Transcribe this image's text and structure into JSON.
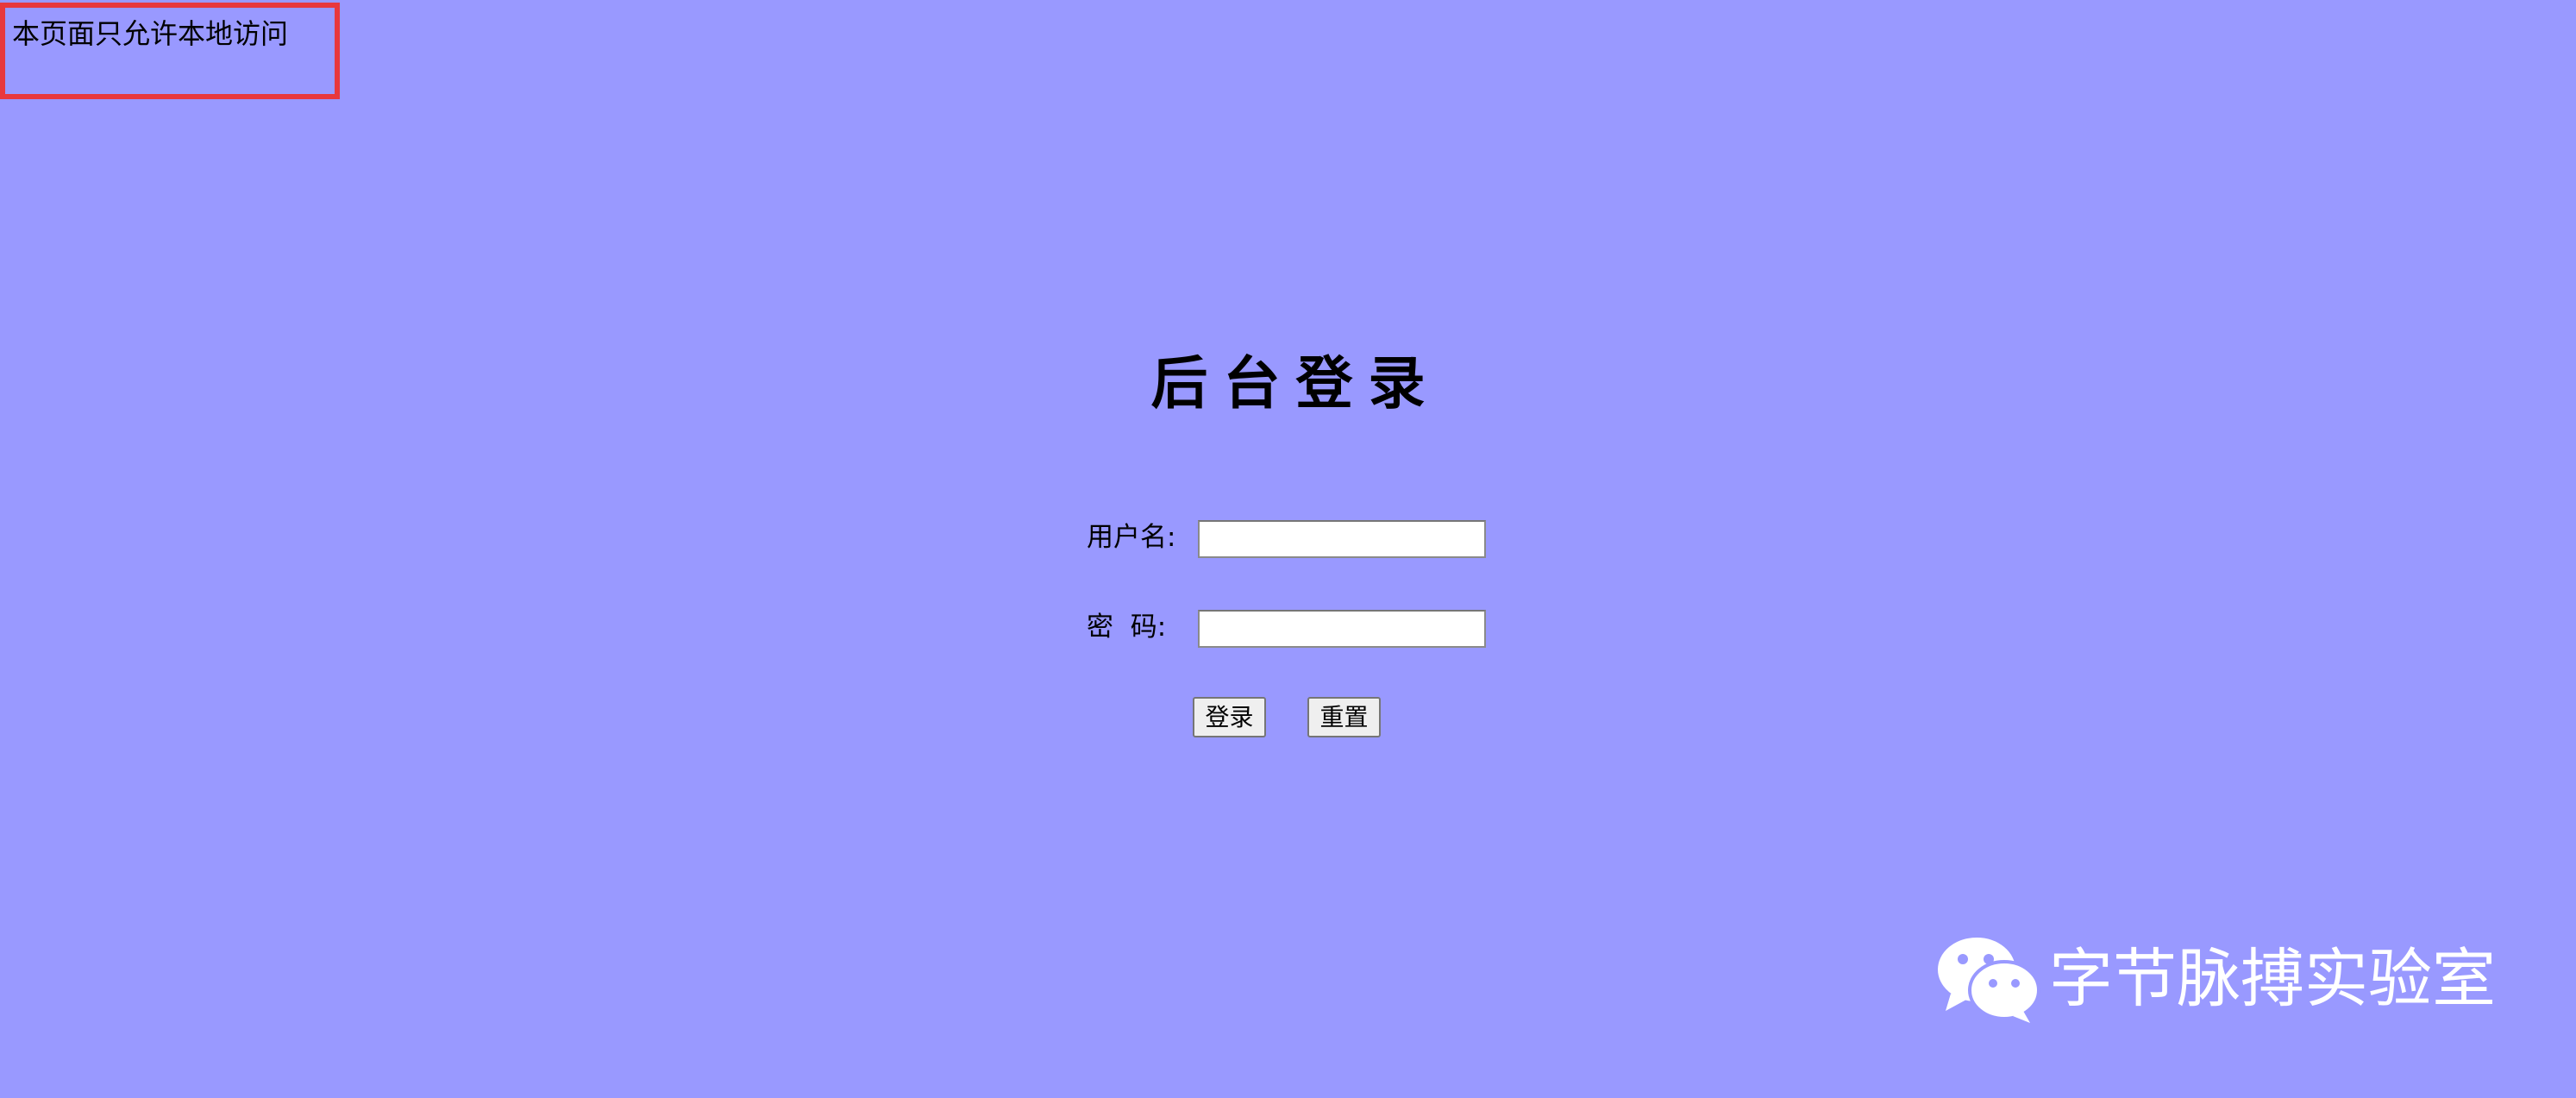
{
  "notice": {
    "text": "本页面只允许本地访问",
    "highlight_color": "#e8383d"
  },
  "login": {
    "title": "后台登录",
    "username_label": "用户名:",
    "password_label": "密  码:",
    "username_value": "",
    "password_value": "",
    "login_button": "登录",
    "reset_button": "重置"
  },
  "watermark": {
    "text": "字节脉搏实验室",
    "icon": "wechat-icon"
  },
  "colors": {
    "background": "#9999ff",
    "watermark_text": "#ffffff"
  }
}
